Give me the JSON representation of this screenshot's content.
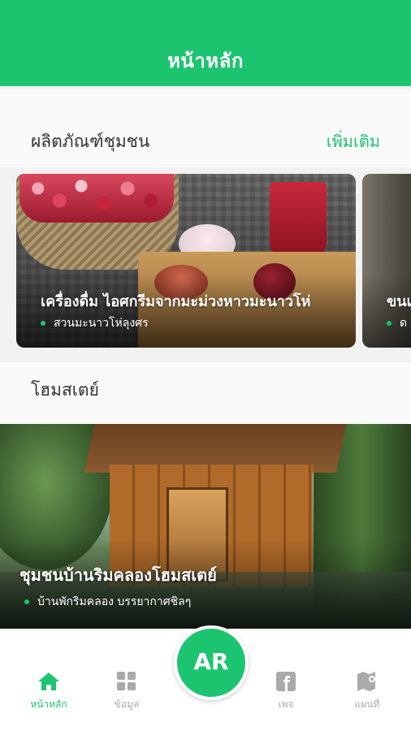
{
  "appbar": {
    "title": "หน้าหลัก"
  },
  "products": {
    "title": "ผลิตภัณฑ์ชุมชน",
    "more_label": "เพิ่มเติม",
    "cards": [
      {
        "title": "เครื่องดื่ม ไอศกรีมจากมะม่วงหาวมะนาวโห่",
        "place": "สวนมะนาวโห่ลุงศร"
      },
      {
        "title": "ขนเ",
        "place": "ด"
      }
    ]
  },
  "homestay": {
    "title": "โฮมสเตย์",
    "card": {
      "title": "ชุมชนบ้านริมคลองโฮมสเตย์",
      "place": "บ้านพักริมคลอง บรรยากาศชิลๆ"
    }
  },
  "bottom_nav": {
    "items": [
      {
        "label": "หน้าหลัก",
        "icon": "home-icon",
        "active": true
      },
      {
        "label": "ข้อมูล",
        "icon": "grid-icon",
        "active": false
      },
      {
        "label": "เพจ",
        "icon": "facebook-icon",
        "active": false
      },
      {
        "label": "แผนที่",
        "icon": "map-icon",
        "active": false
      }
    ],
    "ar_label": "AR"
  },
  "colors": {
    "accent": "#1dc46f",
    "inactive": "#aaaaaa"
  }
}
